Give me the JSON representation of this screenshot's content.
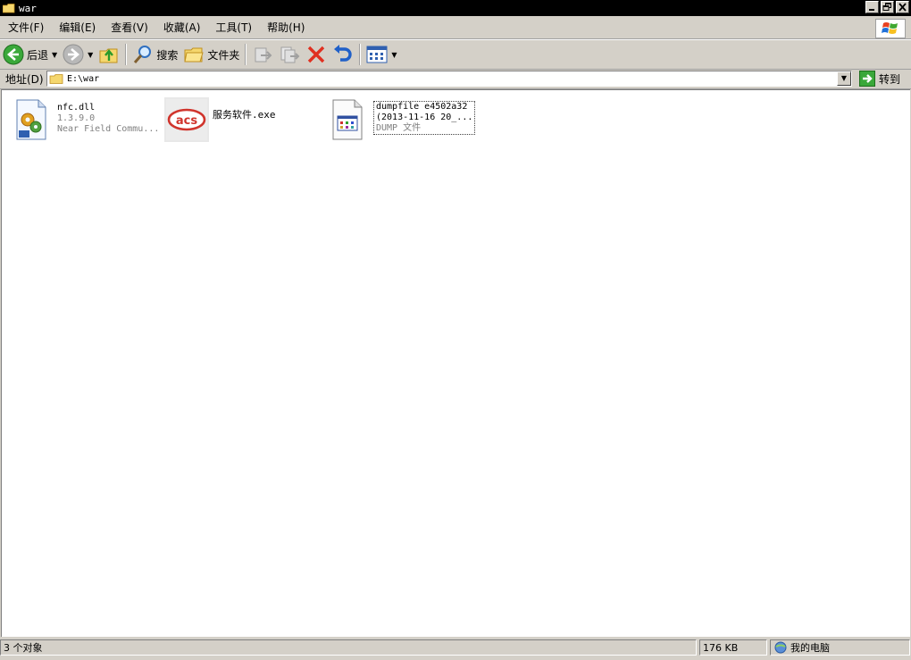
{
  "window": {
    "title": "war"
  },
  "menu": [
    {
      "label": "文件(F)"
    },
    {
      "label": "编辑(E)"
    },
    {
      "label": "查看(V)"
    },
    {
      "label": "收藏(A)"
    },
    {
      "label": "工具(T)"
    },
    {
      "label": "帮助(H)"
    }
  ],
  "toolbar": {
    "back_label": "后退",
    "search_label": "搜索",
    "folders_label": "文件夹"
  },
  "address": {
    "label": "地址(D)",
    "value": "E:\\war",
    "go_label": "转到"
  },
  "files": [
    {
      "name": "nfc.dll",
      "line2": "1.3.9.0",
      "line3": "Near Field Commu..."
    },
    {
      "name": "服务软件.exe",
      "line2": "",
      "line3": ""
    },
    {
      "name": "dumpfile e4502a32",
      "line2": "(2013-11-16 20_...",
      "line3": "DUMP 文件"
    }
  ],
  "status": {
    "objects": "3 个对象",
    "size": "176 KB",
    "location": "我的电脑"
  },
  "colors": {
    "face": "#d4d0c8",
    "titlebar": "#000000",
    "acs_red": "#d0342c",
    "back_green": "#3aa83a",
    "delete_red": "#e03020",
    "undo_blue": "#2060c8"
  }
}
